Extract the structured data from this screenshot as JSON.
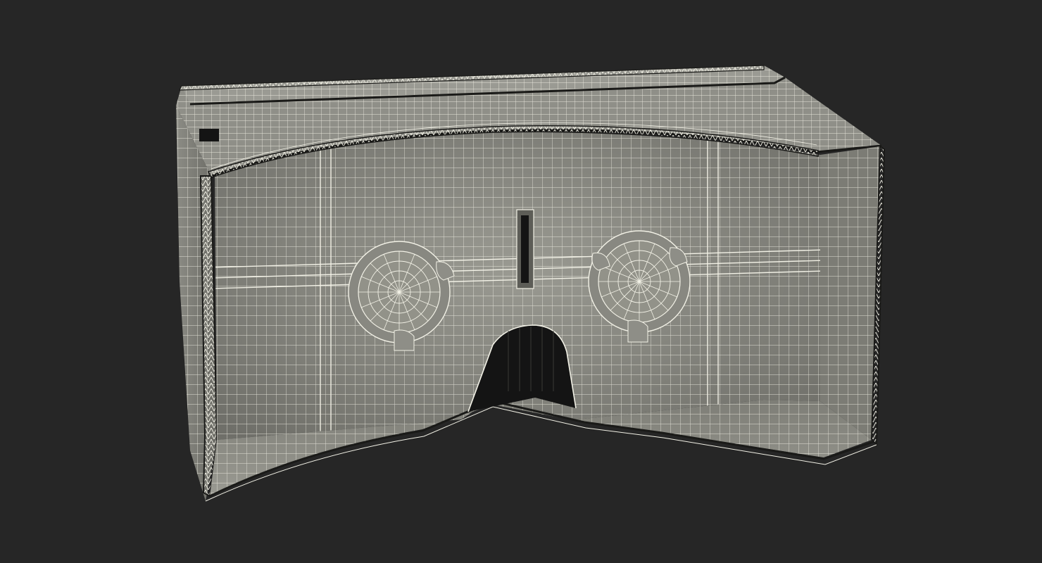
{
  "scene": {
    "background_color": "#262626",
    "subject": "cardboard-vr-viewer-wireframe",
    "surface_color": "#8a8a82",
    "surface_dark_color": "#5d5d57",
    "wire_color": "#f2f1e6",
    "edge_color": "#1a1a18",
    "cutout_color": "#141414"
  }
}
